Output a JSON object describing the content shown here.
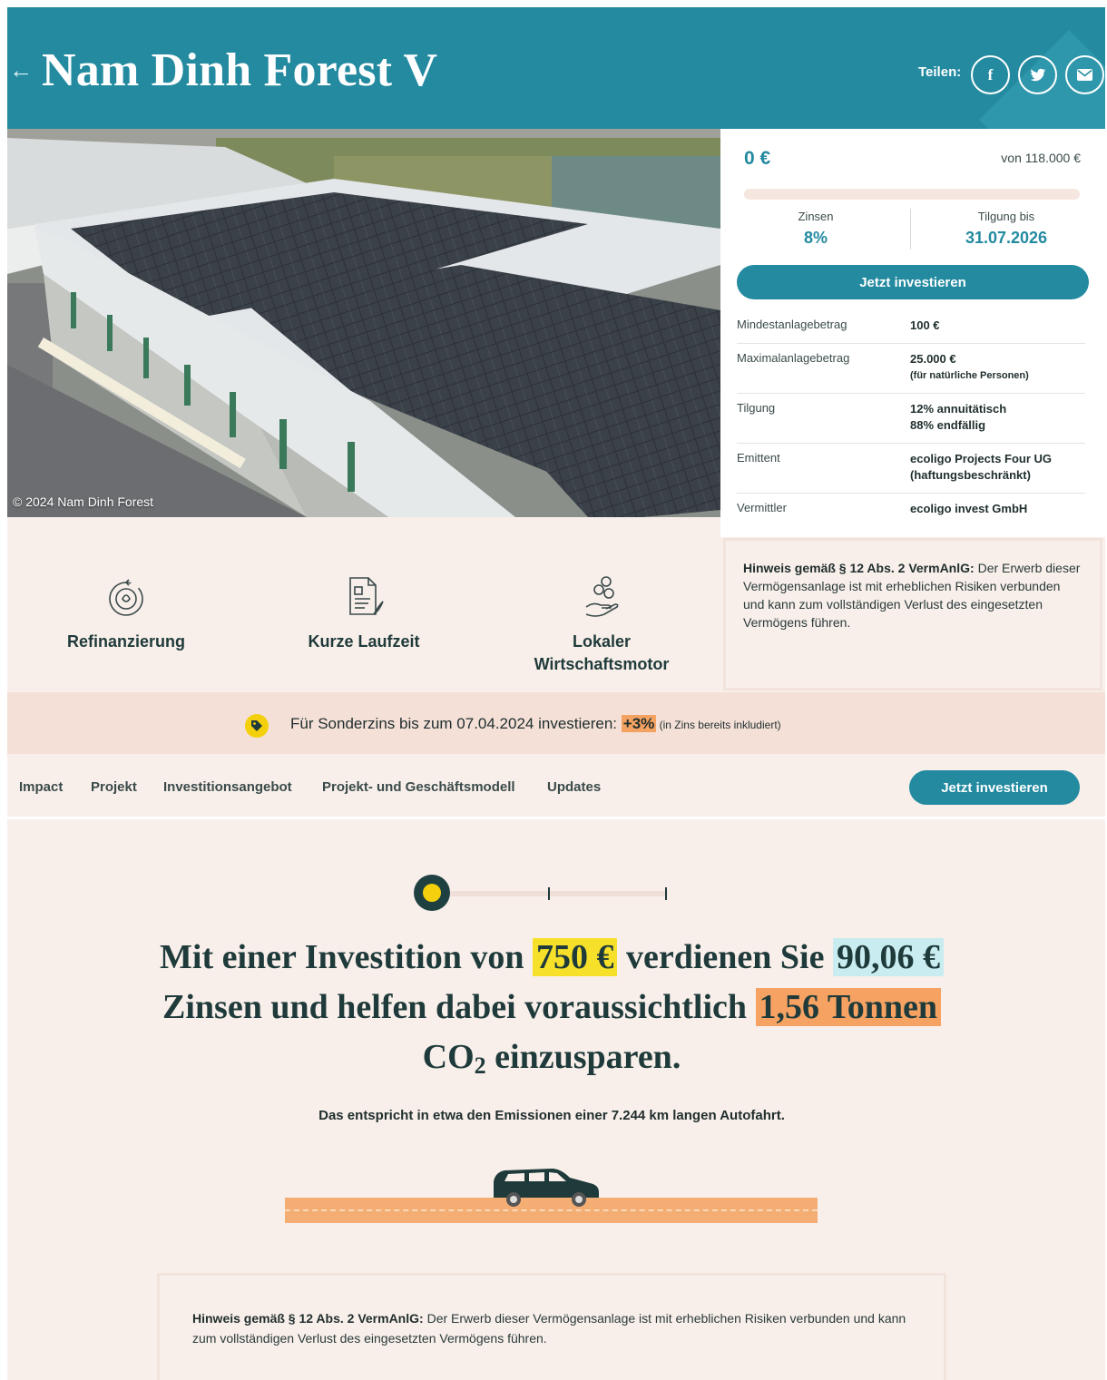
{
  "header": {
    "title": "Nam Dinh Forest V",
    "share_label": "Teilen:",
    "share_icons": [
      "facebook-icon",
      "twitter-icon",
      "mail-icon"
    ],
    "accent_color": "#238aa0"
  },
  "photo": {
    "credit": "© 2024 Nam Dinh Forest"
  },
  "funding": {
    "current": "0 €",
    "target": "von 118.000 €",
    "progress_fraction": 0,
    "interest_label": "Zinsen",
    "interest_value": "8%",
    "repayment_label": "Tilgung bis",
    "repayment_value": "31.07.2026",
    "cta": "Jetzt investieren",
    "details": [
      {
        "label": "Mindestanlagebetrag",
        "value": "100 €",
        "sub": ""
      },
      {
        "label": "Maximalanlagebetrag",
        "value": "25.000 €",
        "sub": "(für natürliche Personen)"
      },
      {
        "label": "Tilgung",
        "value": "12% annuitätisch",
        "sub": "88% endfällig"
      },
      {
        "label": "Emittent",
        "value": "ecoligo Projects Four UG",
        "sub": "(haftungsbeschränkt)"
      },
      {
        "label": "Vermittler",
        "value": "ecoligo invest GmbH",
        "sub": ""
      }
    ]
  },
  "hint": {
    "bold": "Hinweis gemäß § 12 Abs. 2 VermAnlG:",
    "text": " Der Erwerb dieser Vermögensanlage ist mit erheblichen Risiken verbunden und kann zum vollständigen Verlust des eingesetzten Vermögens führen."
  },
  "features": [
    {
      "label": "Refinanzierung",
      "icon": "refinancing-icon"
    },
    {
      "label": "Kurze Laufzeit",
      "icon": "document-icon"
    },
    {
      "label": "Lokaler Wirtschaftsmotor",
      "icon": "coins-hand-icon"
    }
  ],
  "promo": {
    "text": "Für Sonderzins bis zum 07.04.2024 investieren: ",
    "bonus": "+3%",
    "note": " (in Zins bereits inkludiert)"
  },
  "nav": {
    "items": [
      "Impact",
      "Projekt",
      "Investitionsangebot",
      "Projekt- und Geschäftsmodell",
      "Updates"
    ],
    "cta": "Jetzt investieren"
  },
  "calculator": {
    "slider_position": 0,
    "text1": "Mit einer Investition von ",
    "investment": "750 €",
    "text2": " verdienen Sie ",
    "interest": "90,06 €",
    "text3": " Zinsen und helfen dabei voraussichtlich ",
    "co2_amount": "1,56 Tonnen",
    "text4a": " CO",
    "text4sub": "2",
    "text4b": " einzusparen.",
    "equivalent": "Das entspricht in etwa den Emissionen einer 7.244 km langen Autofahrt."
  }
}
